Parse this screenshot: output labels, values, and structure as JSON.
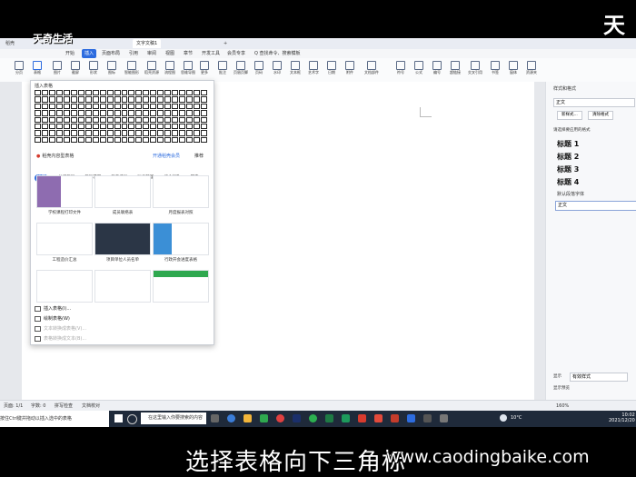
{
  "watermark_logo_top_left": "天奇生活",
  "watermark_logo_top_right": "天",
  "tabs": [
    {
      "label": "稻壳"
    },
    {
      "label": "文字文稿1"
    },
    {
      "label": "+"
    }
  ],
  "ribbon_tabs": [
    "开始",
    "插入",
    "页面布局",
    "引用",
    "审阅",
    "视图",
    "章节",
    "开发工具",
    "会员专享",
    "Q 查找命令、搜索模板"
  ],
  "ribbon_active_tab": "插入",
  "ribbon_buttons": [
    {
      "label": "分页",
      "icon": "page-break-icon"
    },
    {
      "label": "表格",
      "icon": "table-icon"
    },
    {
      "label": "图片",
      "icon": "image-icon"
    },
    {
      "label": "截屏",
      "icon": "screenshot-icon"
    },
    {
      "label": "形状",
      "icon": "shape-icon"
    },
    {
      "label": "图标",
      "icon": "icons-icon"
    },
    {
      "label": "智能图形",
      "icon": "smartart-icon"
    },
    {
      "label": "稻壳资源",
      "icon": "resource-icon"
    },
    {
      "label": "流程图",
      "icon": "flowchart-icon"
    },
    {
      "label": "思维导图",
      "icon": "mindmap-icon"
    },
    {
      "label": "更多",
      "icon": "more-icon"
    },
    {
      "label": "批注",
      "icon": "comment-icon"
    },
    {
      "label": "页眉页脚",
      "icon": "header-icon"
    },
    {
      "label": "页码",
      "icon": "page-number-icon"
    },
    {
      "label": "水印",
      "icon": "watermark-icon"
    },
    {
      "label": "文本框",
      "icon": "textbox-icon"
    },
    {
      "label": "艺术字",
      "icon": "wordart-icon"
    },
    {
      "label": "日期",
      "icon": "date-icon"
    },
    {
      "label": "附件",
      "icon": "attachment-icon"
    },
    {
      "label": "文档部件",
      "icon": "docpart-icon"
    },
    {
      "label": "符号",
      "icon": "symbol-icon"
    },
    {
      "label": "公式",
      "icon": "formula-icon"
    },
    {
      "label": "编号",
      "icon": "numbering-icon"
    },
    {
      "label": "超链接",
      "icon": "hyperlink-icon"
    },
    {
      "label": "交叉引用",
      "icon": "crossref-icon"
    },
    {
      "label": "书签",
      "icon": "bookmark-icon"
    },
    {
      "label": "窗体",
      "icon": "form-icon"
    },
    {
      "label": "资源夹",
      "icon": "folder-icon"
    }
  ],
  "table_dropdown": {
    "title": "插入表格",
    "link_left": "稻壳内容型表格",
    "link_mid": "开通稻壳会员",
    "link_right": "推荐",
    "categories": [
      "推荐",
      "总结汇报",
      "简历求职",
      "教育培训",
      "财务管理",
      "综合行政",
      "其它"
    ],
    "templates": [
      {
        "caption": "学校课程打印文件"
      },
      {
        "caption": "成员联络表"
      },
      {
        "caption": "月度报表对照"
      },
      {
        "caption": "工程造价汇总"
      },
      {
        "caption": "项目单位人员名单"
      },
      {
        "caption": "行政开会进度表格"
      }
    ],
    "menu": [
      {
        "label": "插入表格(I)...",
        "disabled": false
      },
      {
        "label": "绘制表格(W)",
        "disabled": false
      },
      {
        "label": "文本转换成表格(V)...",
        "disabled": true
      },
      {
        "label": "表格转换成文本(B)...",
        "disabled": true
      }
    ]
  },
  "right_pane": {
    "title": "样式和格式",
    "current_style": "正文",
    "btn_new": "新样式...",
    "btn_clear": "清除格式",
    "apply_label": "请选择要应用的格式",
    "styles": [
      "标题 1",
      "标题 2",
      "标题 3",
      "标题 4"
    ],
    "default_font": "默认段落字体",
    "selected": "正文",
    "show_label": "显示",
    "show_value": "有效样式",
    "preview_label": "显示预览"
  },
  "status_bar": {
    "page": "页面: 1/1",
    "words": "字数: 0",
    "spell": "拼写检查",
    "doc_check": "文档校对",
    "zoom": "160%"
  },
  "hint_text": "按住Ctrl键并拖动以插入选中的表格",
  "taskbar": {
    "search_placeholder": "在这里输入你要搜索的内容",
    "temp": "10°C",
    "time": "10:02",
    "date": "2021/12/20"
  },
  "subtitle": "选择表格向下三角标",
  "watermark_url": "www.caodingbaike.com"
}
